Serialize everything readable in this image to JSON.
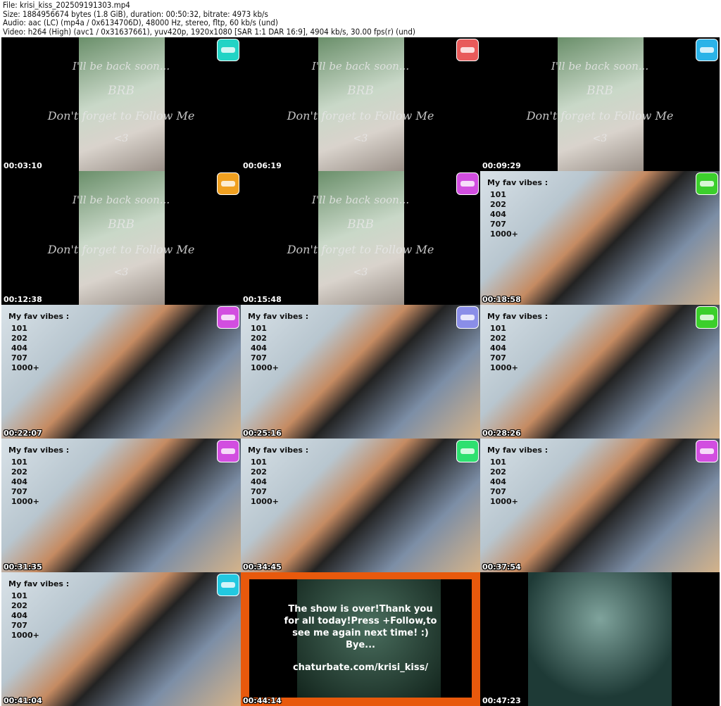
{
  "header": {
    "file": "File: krisi_kiss_202509191303.mp4",
    "size": "Size: 1884956674 bytes (1.8 GiB), duration: 00:50:32, bitrate: 4973 kb/s",
    "audio": "Audio: aac (LC) (mp4a / 0x6134706D), 48000 Hz, stereo, fltp, 60 kb/s (und)",
    "video": "Video: h264 (High) (avc1 / 0x31637661), yuv420p, 1920x1080 [SAR 1:1 DAR 16:9], 4904 kb/s, 30.00 fps(r) (und)"
  },
  "brb": {
    "line1": "I'll be back soon...",
    "line2": "BRB",
    "line3": "Don't forget to Follow Me",
    "line4": "<3"
  },
  "vibes": {
    "title": "My fav vibes :",
    "levels": [
      "101",
      "202",
      "404",
      "707",
      "1000+"
    ]
  },
  "end": {
    "message": "The show is over!Thank you for all today!Press +Follow,to see me again next time! :) Bye...",
    "url": "chaturbate.com/krisi_kiss/"
  },
  "tiles": [
    {
      "type": "brb",
      "time": "00:03:10",
      "badge": "#22d3c5"
    },
    {
      "type": "brb",
      "time": "00:06:19",
      "badge": "#e85a5a"
    },
    {
      "type": "brb",
      "time": "00:09:29",
      "badge": "#2ab3e8"
    },
    {
      "type": "brb",
      "time": "00:12:38",
      "badge": "#f0a020"
    },
    {
      "type": "brb",
      "time": "00:15:48",
      "badge": "#d24ee0"
    },
    {
      "type": "vibes",
      "time": "00:18:58",
      "badge": "#3ccf2c"
    },
    {
      "type": "vibes",
      "time": "00:22:07",
      "badge": "#d24ee0"
    },
    {
      "type": "vibes",
      "time": "00:25:16",
      "badge": "#8a8ee8"
    },
    {
      "type": "vibes",
      "time": "00:28:26",
      "badge": "#3ccf2c"
    },
    {
      "type": "vibes",
      "time": "00:31:35",
      "badge": "#d24ee0"
    },
    {
      "type": "vibes",
      "time": "00:34:45",
      "badge": "#2ee070"
    },
    {
      "type": "vibes",
      "time": "00:37:54",
      "badge": "#d24ee0"
    },
    {
      "type": "vibes",
      "time": "00:41:04",
      "badge": "#22c8e0"
    },
    {
      "type": "end",
      "time": "00:44:14"
    },
    {
      "type": "img",
      "time": "00:47:23"
    }
  ]
}
